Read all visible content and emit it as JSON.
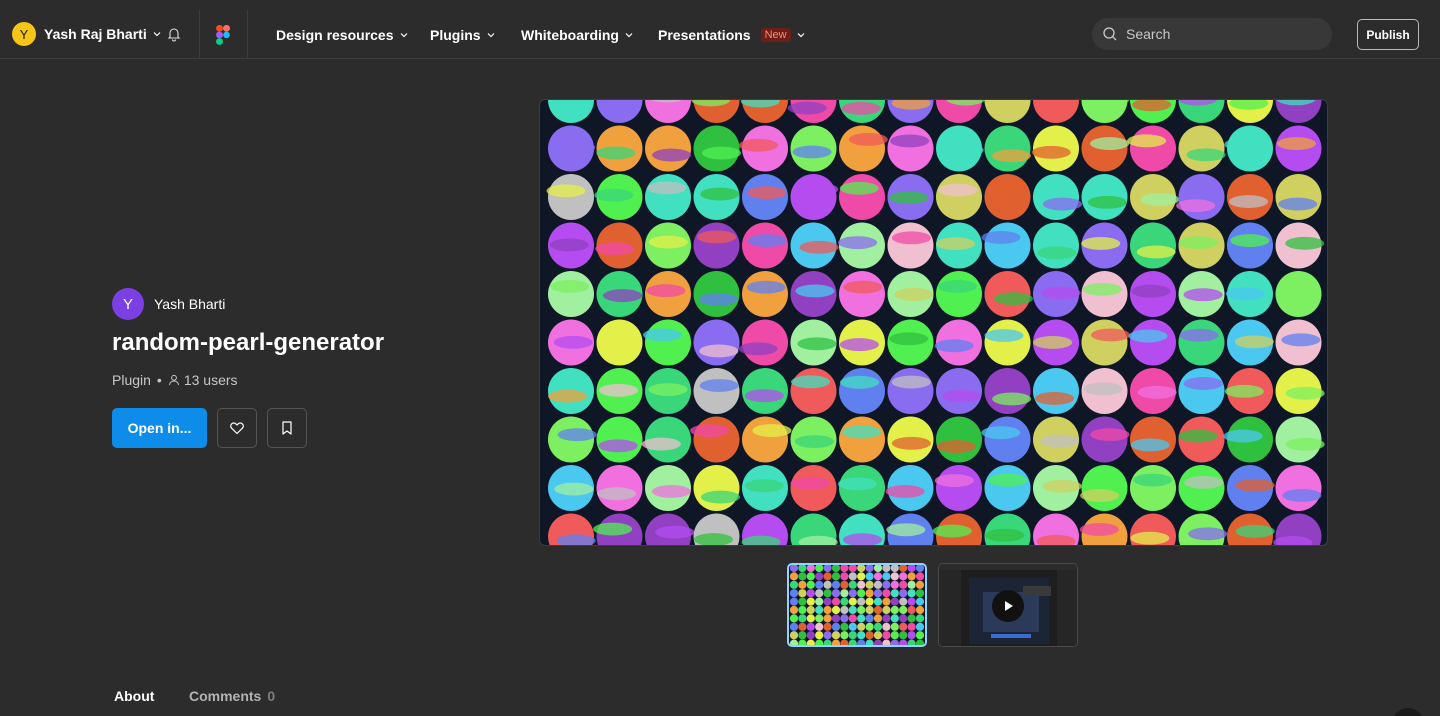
{
  "topbar": {
    "user_initial": "Y",
    "user_name": "Yash Raj Bharti",
    "nav": [
      {
        "label": "Design resources"
      },
      {
        "label": "Plugins"
      },
      {
        "label": "Whiteboarding"
      },
      {
        "label": "Presentations",
        "badge": "New"
      }
    ],
    "search_placeholder": "Search",
    "publish_label": "Publish"
  },
  "plugin": {
    "author_initial": "Y",
    "author_name": "Yash Bharti",
    "title": "random-pearl-generator",
    "type": "Plugin",
    "users": "13 users",
    "open_label": "Open in..."
  },
  "tabs": {
    "about": "About",
    "comments": "Comments",
    "comments_count": "0"
  },
  "colors": {
    "accent": "#0d8ce9",
    "background": "#2c2c2c",
    "hero_bg": "#0f1726"
  },
  "icons": [
    "chevron-down-icon",
    "bell-icon",
    "figma-logo",
    "search-icon",
    "heart-icon",
    "bookmark-icon",
    "user-icon",
    "play-icon"
  ]
}
